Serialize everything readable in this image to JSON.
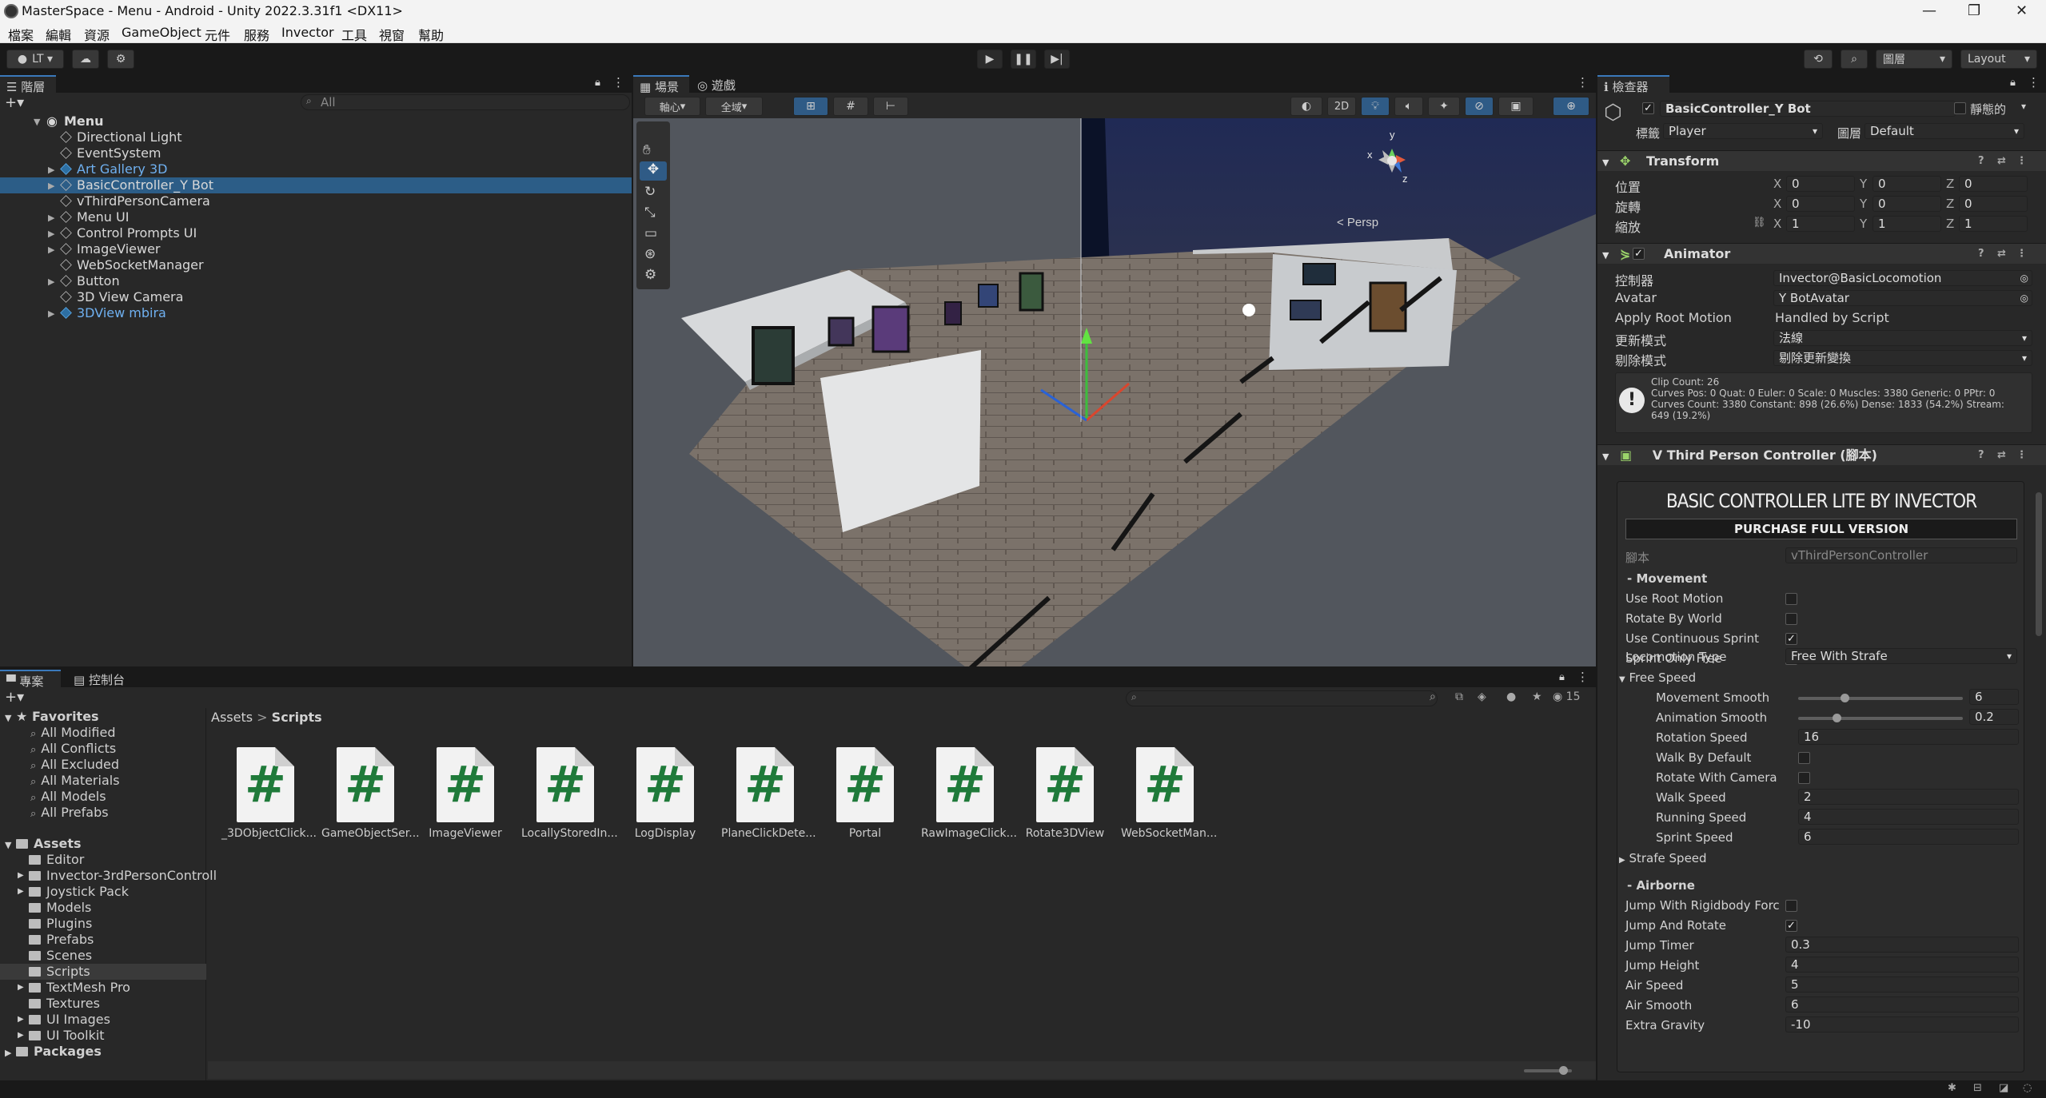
{
  "window": {
    "title": "MasterSpace - Menu - Android - Unity 2022.3.31f1 <DX11>"
  },
  "menu": [
    "檔案",
    "編輯",
    "資源",
    "GameObject",
    "元件",
    "服務",
    "Invector",
    "工具",
    "視窗",
    "幫助"
  ],
  "toolbar": {
    "account": "LT",
    "layers_label": "圖層",
    "layout_label": "Layout"
  },
  "hierarchy": {
    "tab": "階層",
    "search_placeholder": "All",
    "scene": "Menu",
    "items": [
      {
        "label": "Directional Light",
        "prefab": false,
        "expandable": false,
        "selected": false
      },
      {
        "label": "EventSystem",
        "prefab": false,
        "expandable": false,
        "selected": false
      },
      {
        "label": "Art Gallery 3D",
        "prefab": true,
        "expandable": true,
        "selected": false
      },
      {
        "label": "BasicController_Y Bot",
        "prefab": false,
        "expandable": true,
        "selected": true
      },
      {
        "label": "vThirdPersonCamera",
        "prefab": false,
        "expandable": false,
        "selected": false
      },
      {
        "label": "Menu UI",
        "prefab": false,
        "expandable": true,
        "selected": false
      },
      {
        "label": "Control Prompts UI",
        "prefab": false,
        "expandable": true,
        "selected": false
      },
      {
        "label": "ImageViewer",
        "prefab": false,
        "expandable": true,
        "selected": false
      },
      {
        "label": "WebSocketManager",
        "prefab": false,
        "expandable": false,
        "selected": false
      },
      {
        "label": "Button",
        "prefab": false,
        "expandable": true,
        "selected": false
      },
      {
        "label": "3D View Camera",
        "prefab": false,
        "expandable": false,
        "selected": false
      },
      {
        "label": "3DView mbira",
        "prefab": true,
        "expandable": true,
        "selected": false
      }
    ]
  },
  "scene": {
    "tabs": [
      "場景",
      "遊戲"
    ],
    "pivot": "軸心",
    "global": "全域",
    "mode_2d": "2D",
    "persp": "< Persp",
    "gizmo_y": "y",
    "gizmo_x": "x",
    "gizmo_z": "z"
  },
  "project": {
    "tabs": [
      "專案",
      "控制台"
    ],
    "breadcrumb_root": "Assets",
    "breadcrumb_current": "Scripts",
    "hidden_count": "15",
    "favorites_label": "Favorites",
    "favorites": [
      "All Modified",
      "All Conflicts",
      "All Excluded",
      "All Materials",
      "All Models",
      "All Prefabs"
    ],
    "assets_label": "Assets",
    "folders": [
      {
        "label": "Editor",
        "expandable": false
      },
      {
        "label": "Invector-3rdPersonControll",
        "expandable": true
      },
      {
        "label": "Joystick Pack",
        "expandable": true
      },
      {
        "label": "Models",
        "expandable": false
      },
      {
        "label": "Plugins",
        "expandable": false
      },
      {
        "label": "Prefabs",
        "expandable": false
      },
      {
        "label": "Scenes",
        "expandable": false
      },
      {
        "label": "Scripts",
        "expandable": false
      },
      {
        "label": "TextMesh Pro",
        "expandable": true
      },
      {
        "label": "Textures",
        "expandable": false
      },
      {
        "label": "UI Images",
        "expandable": true
      },
      {
        "label": "UI Toolkit",
        "expandable": true
      }
    ],
    "packages_label": "Packages",
    "files": [
      "_3DObjectClick...",
      "GameObjectSer...",
      "ImageViewer",
      "LocallyStoredIn...",
      "LogDisplay",
      "PlaneClickDete...",
      "Portal",
      "RawImageClick...",
      "Rotate3DView",
      "WebSocketMan..."
    ],
    "file_glyph": "#"
  },
  "inspector": {
    "tab": "檢查器",
    "object_name": "BasicController_Y Bot",
    "static_label": "靜態的",
    "tag_label": "標籤",
    "tag_value": "Player",
    "layer_label": "圖層",
    "layer_value": "Default",
    "transform": {
      "title": "Transform",
      "rows": [
        {
          "label": "位置",
          "x": "0",
          "y": "0",
          "z": "0"
        },
        {
          "label": "旋轉",
          "x": "0",
          "y": "0",
          "z": "0"
        },
        {
          "label": "縮放",
          "x": "1",
          "y": "1",
          "z": "1"
        }
      ]
    },
    "animator": {
      "title": "Animator",
      "controller_label": "控制器",
      "controller_value": "Invector@BasicLocomotion",
      "avatar_label": "Avatar",
      "avatar_value": "Y BotAvatar",
      "root_motion_label": "Apply Root Motion",
      "root_motion_value": "Handled by Script",
      "update_label": "更新模式",
      "update_value": "法線",
      "cull_label": "剔除模式",
      "cull_value": "剔除更新變換",
      "info1": "Clip Count: 26",
      "info2": "Curves Pos: 0 Quat: 0 Euler: 0 Scale: 0 Muscles: 3380 Generic: 0 PPtr: 0",
      "info3": "Curves Count: 3380 Constant: 898 (26.6%) Dense: 1833 (54.2%) Stream:",
      "info4": "649 (19.2%)"
    },
    "controller": {
      "title": "V Third Person Controller (腳本)",
      "banner": "BASIC CONTROLLER LITE BY INVECTOR",
      "purchase": "PURCHASE FULL VERSION",
      "script_label": "腳本",
      "script_value": "vThirdPersonController",
      "movement_header": "- Movement",
      "movement": [
        {
          "label": "Use Root Motion",
          "checked": false
        },
        {
          "label": "Rotate By World",
          "checked": false
        },
        {
          "label": "Use Continuous Sprint",
          "checked": true
        },
        {
          "label": "Sprint Only Free",
          "checked": true
        }
      ],
      "locomotion_label": "Locomotion Type",
      "locomotion_value": "Free With Strafe",
      "free_speed_label": "Free Speed",
      "movement_smooth_label": "Movement Smooth",
      "movement_smooth_value": "6",
      "movement_smooth_level": 0.27,
      "animation_smooth_label": "Animation Smooth",
      "animation_smooth_value": "0.2",
      "animation_smooth_level": 0.22,
      "rotation_speed_label": "Rotation Speed",
      "rotation_speed_value": "16",
      "walk_default_label": "Walk By Default",
      "rotate_camera_label": "Rotate With Camera",
      "walk_speed_label": "Walk Speed",
      "walk_speed_value": "2",
      "running_speed_label": "Running Speed",
      "running_speed_value": "4",
      "sprint_speed_label": "Sprint Speed",
      "sprint_speed_value": "6",
      "strafe_speed_label": "Strafe Speed",
      "airborne_header": "- Airborne",
      "jump_force_label": "Jump With Rigidbody Forc",
      "jump_rotate_label": "Jump And Rotate",
      "jump_timer_label": "Jump Timer",
      "jump_timer_value": "0.3",
      "jump_height_label": "Jump Height",
      "jump_height_value": "4",
      "air_speed_label": "Air Speed",
      "air_speed_value": "5",
      "air_smooth_label": "Air Smooth",
      "air_smooth_value": "6",
      "extra_gravity_label": "Extra Gravity",
      "extra_gravity_value": "-10"
    }
  },
  "colors": {
    "accent": "#3a79bb",
    "selection": "#2c5d87",
    "prefab": "#6fb0f0",
    "script_green": "#1f7a3a"
  }
}
